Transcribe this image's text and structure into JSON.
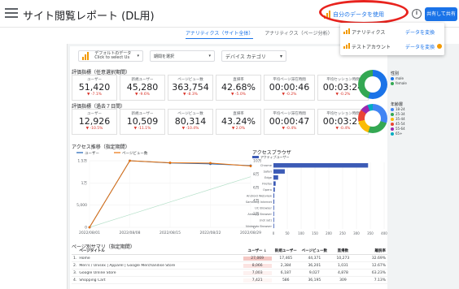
{
  "app": {
    "title": "サイト閲覧レポート (DL用)"
  },
  "top": {
    "data_source_label": "自分のデータを使用",
    "share_label": "共有して共有",
    "info_label": "i"
  },
  "dropdown": {
    "items": [
      {
        "label": "アナリティクス",
        "action": "データを変換"
      },
      {
        "label": "テストアカウント",
        "action": "データを変換"
      }
    ]
  },
  "tabs": [
    "アナリティクス（サイト全体）",
    "アナリティクス（ページ分析）"
  ],
  "filters": [
    {
      "line1": "デフォルトのデータ",
      "line2": "Click to select Us"
    },
    {
      "line1": "期間を選択",
      "line2": ""
    },
    {
      "line1": "デバイス カテゴリ",
      "line2": ""
    }
  ],
  "sections": {
    "period1": "評価指標（任意選択期間）",
    "period2": "評価指標（過去７日間）"
  },
  "kpi_period1": [
    {
      "label": "ユーザー",
      "value": "51,420",
      "change": "▼ -7.1%"
    },
    {
      "label": "新規ユーザー",
      "value": "45,280",
      "change": "▼ -9.6%"
    },
    {
      "label": "ページビュー数",
      "value": "363,754",
      "change": "▼ -8.3%"
    },
    {
      "label": "直帰率",
      "value": "42.68%",
      "change": "▼ -5.0%"
    },
    {
      "label": "平均ページ滞在時間",
      "value": "00:00:46",
      "change": "▼ -0.2%"
    },
    {
      "label": "平均セッション時間",
      "value": "00:03:24",
      "change": "▼ -0.2%"
    }
  ],
  "kpi_period2": [
    {
      "label": "ユーザー",
      "value": "12,926",
      "change": "▼ -10.5%"
    },
    {
      "label": "新規ユーザー",
      "value": "10,509",
      "change": "▼ -11.1%"
    },
    {
      "label": "ページビュー数",
      "value": "80,314",
      "change": "▼ -10.4%"
    },
    {
      "label": "直帰率",
      "value": "43.24%",
      "change": "▼ 2.0%"
    },
    {
      "label": "平均ページ滞在時間",
      "value": "00:00:47",
      "change": "▼ -0.4%"
    },
    {
      "label": "平均セッション時間",
      "value": "00:03:21",
      "change": "▼ -0.4%"
    }
  ],
  "donut1": {
    "title": "性別",
    "items": [
      {
        "name": "male",
        "color": "#1a73e8"
      },
      {
        "name": "female",
        "color": "#34a853"
      }
    ]
  },
  "donut2": {
    "title": "年齢層",
    "items": [
      {
        "name": "18-24",
        "color": "#4285f4"
      },
      {
        "name": "25-34",
        "color": "#34a853"
      },
      {
        "name": "35-44",
        "color": "#fbbc04"
      },
      {
        "name": "45-54",
        "color": "#ea4335"
      },
      {
        "name": "55-64",
        "color": "#9c27b0"
      },
      {
        "name": "65+",
        "color": "#00acc1"
      }
    ]
  },
  "chart_titles": {
    "trend": "アクセス推移（指定期間）",
    "browser": "アクセスブラウザ",
    "table": "ページ別サマリ（指定期間）"
  },
  "chart_data": [
    {
      "type": "line",
      "title": "アクセス推移（指定期間）",
      "x": [
        "2022/08/01",
        "2022/08/08",
        "2022/08/15",
        "2022/08/22",
        "2022/08/29"
      ],
      "series": [
        {
          "name": "ユーザー",
          "axis": "left",
          "values": [
            0,
            15000,
            14500,
            14300,
            13900
          ],
          "color": "#1a5fb4"
        },
        {
          "name": "ページビュー数",
          "axis": "right",
          "values": [
            0,
            100000,
            97000,
            96500,
            92000
          ],
          "color": "#e8710a"
        }
      ],
      "yleft_ticks": [
        "0",
        "5,000",
        "1万",
        "1.5万"
      ],
      "yright_ticks": [
        "0",
        "2万",
        "4万",
        "6万",
        "8万",
        "10万"
      ]
    },
    {
      "type": "bar",
      "title": "アクセスブラウザ",
      "legend": "アクティブユーザー",
      "categories": [
        "Chrome",
        "Safari",
        "Edge",
        "Firefox",
        "Opera",
        "Android Webview",
        "Samsung Internet",
        "UC Browser",
        "Android Browser",
        "(not set)",
        "Nintendo Browser"
      ],
      "values": [
        342,
        41,
        17,
        8,
        5,
        3,
        3,
        2,
        1,
        1,
        1
      ],
      "xlim": [
        0,
        400
      ],
      "xticks": [
        "0",
        "50",
        "100",
        "150",
        "200",
        "250",
        "300",
        "350",
        "400"
      ]
    }
  ],
  "table": {
    "headers": {
      "page": "ページタイトル",
      "users": "ユーザー ↓",
      "new_users": "新規ユーザー",
      "views": "ページビュー数",
      "bounce": "直帰数",
      "rate": "離脱率"
    },
    "rows": [
      {
        "idx": "1.",
        "page": "Home",
        "users": "27,069",
        "new_users": "17,465",
        "views": "44,371",
        "bounce": "10,273",
        "rate": "32.69%"
      },
      {
        "idx": "2.",
        "page": "Men's / Unisex | Apparel | Google Merchandise Store",
        "users": "8,066",
        "new_users": "2,384",
        "views": "36,201",
        "bounce": "1,031",
        "rate": "12.67%"
      },
      {
        "idx": "3.",
        "page": "Google Online Store",
        "users": "7,003",
        "new_users": "6,187",
        "views": "9,027",
        "bounce": "4,878",
        "rate": "63.23%"
      },
      {
        "idx": "4.",
        "page": "Shopping Cart",
        "users": "7,421",
        "new_users": "586",
        "views": "36,195",
        "bounce": "309",
        "rate": "7.13%"
      }
    ]
  }
}
